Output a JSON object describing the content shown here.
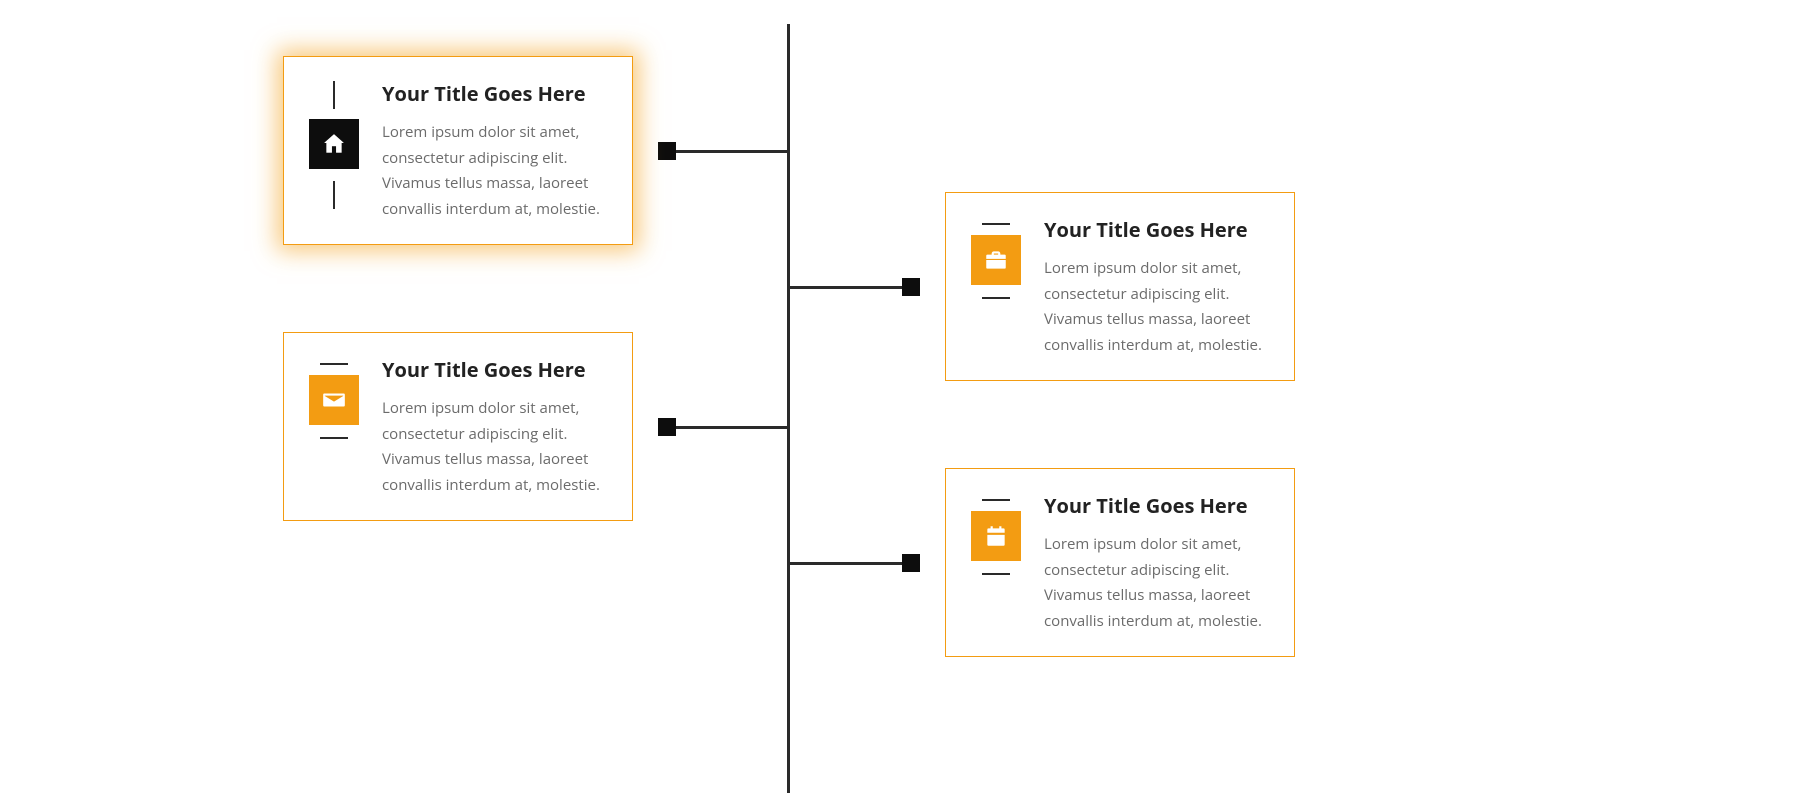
{
  "colors": {
    "accent": "#f39c12",
    "dark": "#2a2a2a",
    "muted": "#6b6b6b"
  },
  "timeline": {
    "items": [
      {
        "side": "left",
        "highlight": true,
        "icon": "home",
        "icon_style": "dark",
        "title": "Your Title Goes Here",
        "body": "Lorem ipsum dolor sit amet, consectetur adipiscing elit. Vivamus tellus massa, laoreet convallis interdum at, molestie."
      },
      {
        "side": "right",
        "highlight": false,
        "icon": "briefcase",
        "icon_style": "orange",
        "title": "Your Title Goes Here",
        "body": "Lorem ipsum dolor sit amet, consectetur adipiscing elit. Vivamus tellus massa, laoreet convallis interdum at, molestie."
      },
      {
        "side": "left",
        "highlight": false,
        "icon": "envelope",
        "icon_style": "orange",
        "title": "Your Title Goes Here",
        "body": "Lorem ipsum dolor sit amet, consectetur adipiscing elit. Vivamus tellus massa, laoreet convallis interdum at, molestie."
      },
      {
        "side": "right",
        "highlight": false,
        "icon": "calendar",
        "icon_style": "orange",
        "title": "Your Title Goes Here",
        "body": "Lorem ipsum dolor sit amet, consectetur adipiscing elit. Vivamus tellus massa, laoreet convallis interdum at, molestie."
      }
    ]
  }
}
